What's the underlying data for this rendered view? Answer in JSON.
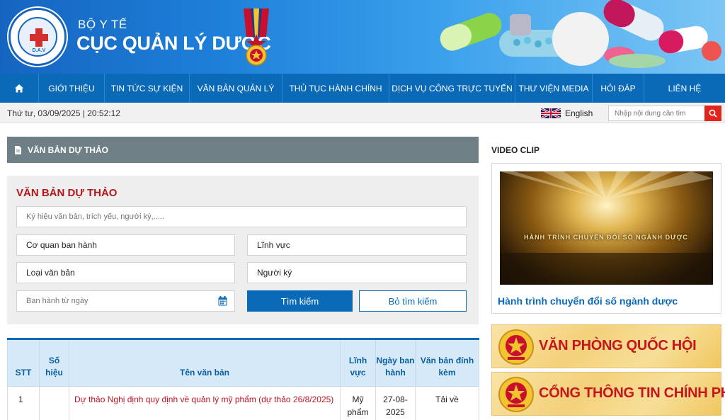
{
  "header": {
    "ministry": "BỘ Y TẾ",
    "title": "CỤC QUẢN LÝ DƯỢC",
    "logo_text": "D.A.V"
  },
  "nav": {
    "home_icon": "home-icon",
    "items": [
      {
        "label": "GIỚI THIỆU"
      },
      {
        "label": "TIN TỨC SỰ KIỆN"
      },
      {
        "label": "VĂN BẢN QUẢN LÝ"
      },
      {
        "label": "THỦ TỤC HÀNH CHÍNH"
      },
      {
        "label": "DỊCH VỤ CÔNG TRỰC TUYẾN"
      },
      {
        "label": "THƯ VIỆN MEDIA"
      },
      {
        "label": "HỎI ĐÁP"
      },
      {
        "label": "LIÊN HỆ"
      }
    ]
  },
  "infobar": {
    "datetime": "Thứ tư, 03/09/2025 | 20:52:12",
    "language": "English",
    "search_placeholder": "Nhập nội dung cần tìm"
  },
  "section": {
    "title": "VĂN BẢN DỰ THẢO"
  },
  "filter": {
    "title": "VĂN BẢN DỰ THẢO",
    "keyword_placeholder": "Ký hiệu văn bản, trích yếu, người ký,.....",
    "agency": "Cơ quan ban hành",
    "field": "Lĩnh vực",
    "doc_type": "Loại văn bản",
    "signer": "Người ký",
    "date_placeholder": "Ban hành từ ngày",
    "search_button": "Tìm kiếm",
    "clear_button": "Bỏ tìm kiếm"
  },
  "table": {
    "headers": {
      "stt": "STT",
      "number": "Số hiệu",
      "name": "Tên văn bản",
      "field": "Lĩnh vực",
      "date": "Ngày ban hành",
      "attachment": "Văn bản đính kèm"
    },
    "rows": [
      {
        "stt": "1",
        "number": "",
        "name": "Dự thảo Nghị định quy định về quản lý mỹ phẩm (dự thảo 26/8/2025)",
        "field": "Mỹ phẩm",
        "date": "27-08-2025",
        "attachment": "Tải về"
      }
    ]
  },
  "sidebar": {
    "video_heading": "VIDEO CLIP",
    "video_overlay": "HÀNH TRÌNH CHUYỂN ĐỔI SỐ NGÀNH DƯỢC",
    "video_caption": "Hành trình chuyển đổi số ngành dược",
    "banners": [
      {
        "label": "VĂN PHÒNG QUỐC HỘI"
      },
      {
        "label": "CỔNG THÔNG TIN CHÍNH PHỦ"
      }
    ]
  },
  "colors": {
    "primary": "#0a6ab8",
    "accent_red": "#c4161c",
    "section_gray": "#6f7f86"
  }
}
